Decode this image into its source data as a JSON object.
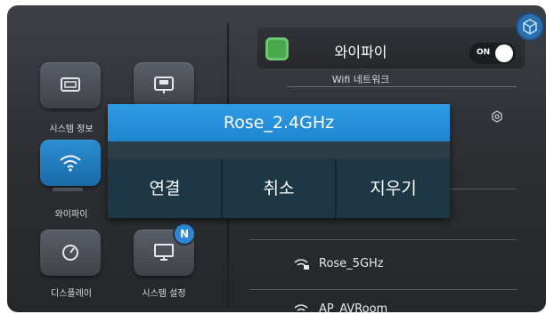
{
  "left_menu": {
    "system_info": "시스템 정보",
    "wifi": "와이파이",
    "display": "디스플레이",
    "system_settings": "시스템 설정",
    "settings_badge": "N"
  },
  "wifi_panel": {
    "title": "와이파이",
    "toggle_state": "ON",
    "subtitle": "Wifi 네트워크",
    "networks": [
      "Rose_5GHz",
      "AP_AVRoom"
    ]
  },
  "dialog": {
    "network_name": "Rose_2.4GHz",
    "connect_label": "연결",
    "cancel_label": "취소",
    "forget_label": "지우기"
  },
  "colors": {
    "accent": "#2f9ae4",
    "dialog_bg": "#1e3745",
    "tile_active": "#2a8fd3"
  }
}
